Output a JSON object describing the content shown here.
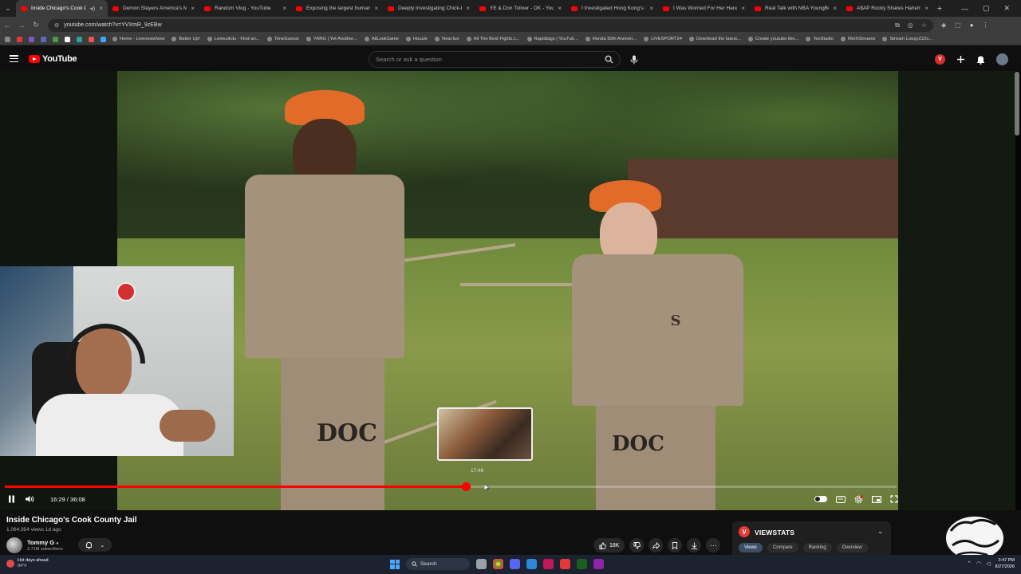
{
  "browser": {
    "tabs": [
      {
        "title": "Inside Chicago's Cook Co",
        "active": true
      },
      {
        "title": "Demon Slayers America's Mo",
        "active": false
      },
      {
        "title": "Random Vlog - YouTube",
        "active": false
      },
      {
        "title": "Exposing the largest human t",
        "active": false
      },
      {
        "title": "Deeply Investigating Chick-Fi",
        "active": false
      },
      {
        "title": "YE & Don Toliver - OK - YouTu",
        "active": false
      },
      {
        "title": "I Investigated Hong Kong's La",
        "active": false
      },
      {
        "title": "I Was Worried For Her Hand",
        "active": false
      },
      {
        "title": "Real Talk with NBA YoungBoy",
        "active": false
      },
      {
        "title": "A$AP Rocky Shares Harlem St",
        "active": false
      }
    ],
    "url": "youtube.com/watch?v=YVXmR_9zEBw",
    "bookmarks": [
      "Home - LivenewsNow",
      "Batter Up!",
      "Leewuifulu - Find an...",
      "TimeGuessr",
      "YARG | Yet Another...",
      "AllLookSame",
      "Houzle",
      "Neal.fun",
      "All The Best Fights.c...",
      "Rapidtags | YouTub...",
      "Honda 50th Anniver...",
      "LIVESPORT24",
      "Download the latest...",
      "Create youtube like...",
      "TexStudio",
      "MethStreams",
      "Stream LoopyZ22s..."
    ]
  },
  "youtube": {
    "logo_text": "YouTube",
    "search_placeholder": "Search or ask a question",
    "player": {
      "current_time": "16:29",
      "duration": "36:08",
      "time_display": "16:29 / 36:08",
      "played_fraction": 0.517,
      "preview_time": "17:46"
    },
    "video": {
      "title": "Inside Chicago's Cook County Jail",
      "meta": "1,064,954 views  1d ago",
      "channel": "Tommy G",
      "subscribers": "3.71M subscribers",
      "like_count": "18K"
    },
    "scene_text": {
      "pants_left": "DOC",
      "pants_right": "DOC",
      "shirt_letter": "S"
    },
    "viewstats": {
      "title": "VIEWSTATS",
      "logo_letter": "V",
      "tabs": [
        "Views",
        "Compare",
        "Ranking",
        "Overview"
      ],
      "active_tab": "Views"
    }
  },
  "taskbar": {
    "weather_text": "Hot days ahead",
    "weather_temp": "84°F",
    "search_label": "Search",
    "time": "3:47 PM",
    "date": "8/27/2026"
  },
  "colors": {
    "accent_red": "#ff0000",
    "bg": "#0f0f0f"
  }
}
